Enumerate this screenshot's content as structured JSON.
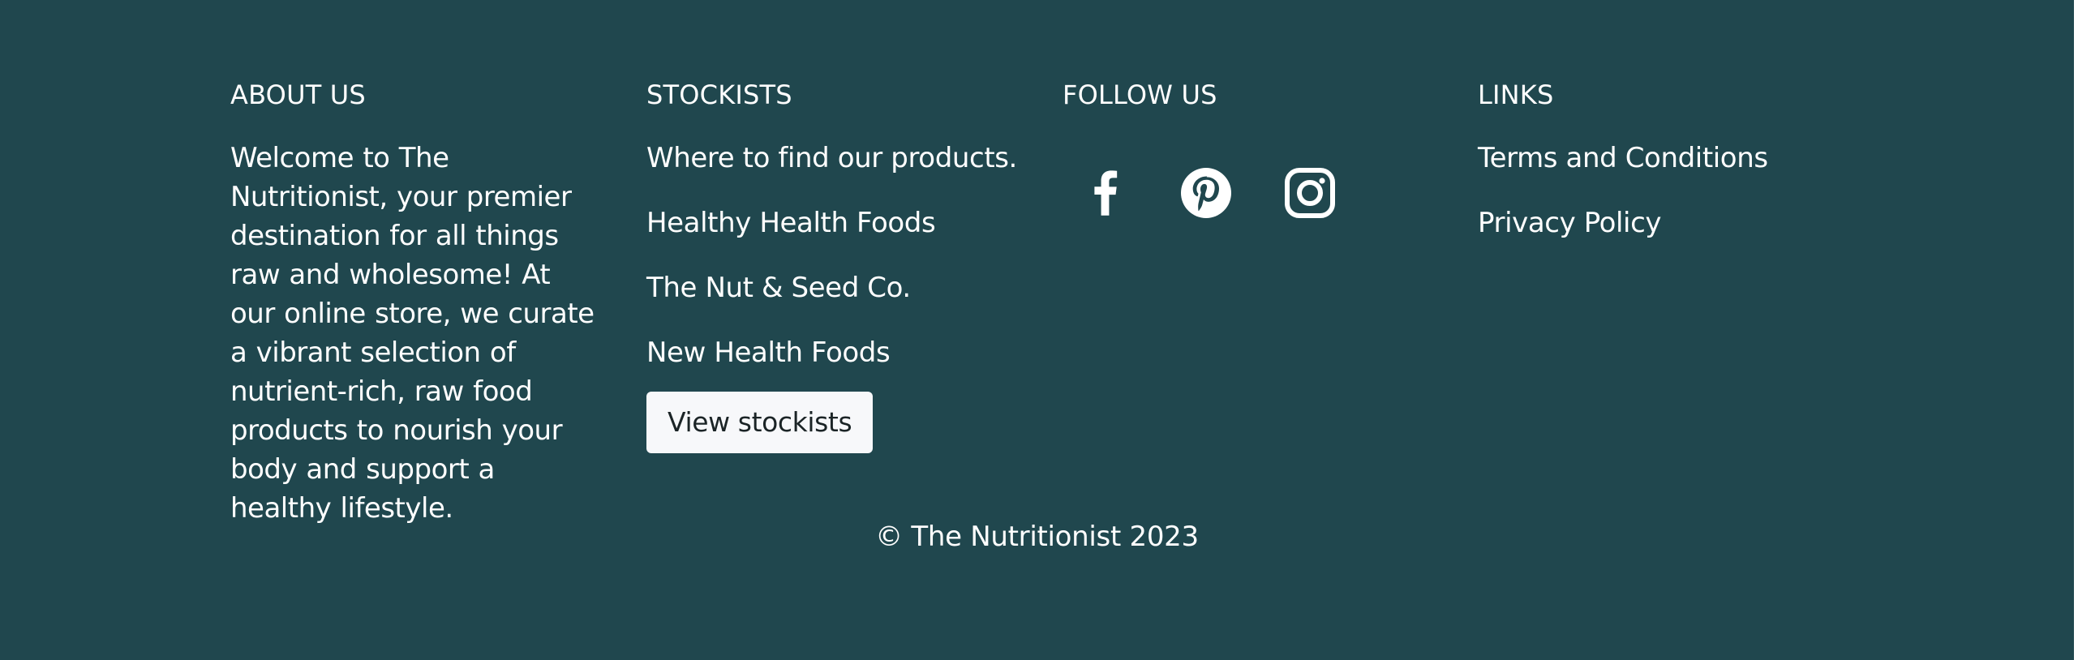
{
  "about": {
    "heading": "ABOUT US",
    "text": "Welcome to The Nutritionist, your premier destination for all things raw and wholesome! At our online store, we curate a vibrant selection of nutrient-rich, raw food products to nourish your body and support a healthy lifestyle."
  },
  "stockists": {
    "heading": "STOCKISTS",
    "items": [
      "Where to find our products.",
      "Healthy Health Foods",
      "The Nut & Seed Co.",
      "New Health Foods"
    ],
    "button_label": "View stockists"
  },
  "follow": {
    "heading": "FOLLOW US",
    "icons": [
      "facebook-icon",
      "pinterest-icon",
      "instagram-icon"
    ]
  },
  "links": {
    "heading": "LINKS",
    "items": [
      "Terms and Conditions",
      "Privacy Policy"
    ]
  },
  "copyright": "© The Nutritionist 2023",
  "colors": {
    "background": "#20474e",
    "text": "#ffffff",
    "button_bg": "#f7f8fa",
    "button_text": "#1b2426"
  }
}
